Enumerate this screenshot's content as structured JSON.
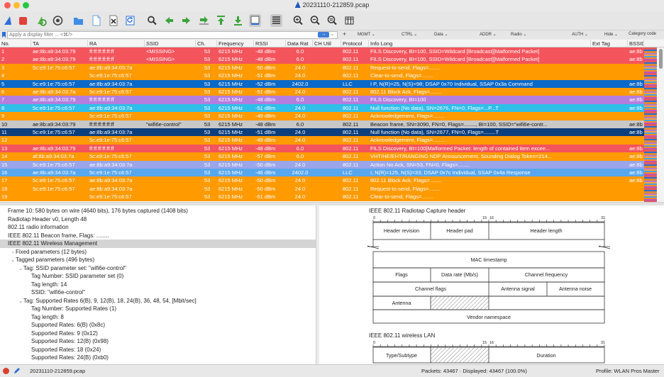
{
  "window": {
    "title": "20231110-212859.pcap"
  },
  "filter": {
    "placeholder": "Apply a display filter ... <⌘/>",
    "apply_label": "→",
    "dropdown_label": "⌄",
    "add_label": "+"
  },
  "quick_buttons": [
    {
      "label": "MGMT ⌄"
    },
    {
      "label": "CTRL ⌄"
    },
    {
      "label": "Data ⌄"
    },
    {
      "label": "ADDR ⌄"
    },
    {
      "label": "Radio ⌄"
    },
    {
      "label": "AUTH ⌄"
    },
    {
      "label": "Hide ⌄"
    },
    {
      "label": "Category code"
    }
  ],
  "toolbar_icons": [
    "shark-fin-start-icon",
    "stop-square-icon",
    "restart-capture-icon",
    "capture-options-icon",
    "open-folder-icon",
    "save-file-icon",
    "close-file-icon",
    "reload-file-icon",
    "find-packet-icon",
    "go-back-icon",
    "go-forward-icon",
    "go-to-packet-icon",
    "go-first-icon",
    "go-last-icon",
    "autoscroll-icon",
    "colorize-icon",
    "zoom-in-icon",
    "zoom-out-icon",
    "zoom-reset-icon",
    "resize-columns-icon"
  ],
  "columns": [
    "No.",
    "TA",
    "RA",
    "SSID",
    "Ch.",
    "Frequency",
    "RSSI",
    "Data Rat",
    "CH Util",
    "Protocol",
    "Info Long",
    "Ext Tag",
    "BSSID"
  ],
  "colors": {
    "red": "#f4545c",
    "orange": "#ff9a00",
    "blue": "#0968c8",
    "purple": "#b47ede",
    "cyan": "#2fbfe8",
    "lightblue": "#57a7ee",
    "lavender": "#9aa5ea",
    "gray": "#c8c8c8",
    "navy": "#0d3f7d"
  },
  "packets": [
    {
      "no": "1",
      "ta": "ae:8b:a9:34:03:79",
      "ra": "ff:ff:ff:ff:ff:ff",
      "ssid": "<MISSING>",
      "ch": "53",
      "freq": "6215 MHz",
      "rssi": "-48 dBm",
      "rate": "6.0",
      "util": "",
      "proto": "802.11",
      "info": "FILS Discovery, BI=100, SSID=Wildcard [Broadcast][Malformed Packet]",
      "ext": "",
      "bssid": "ae:8b",
      "color": "red"
    },
    {
      "no": "2",
      "ta": "ae:8b:a9:34:03:79",
      "ra": "ff:ff:ff:ff:ff:ff",
      "ssid": "<MISSING>",
      "ch": "53",
      "freq": "6215 MHz",
      "rssi": "-48 dBm",
      "rate": "6.0",
      "util": "",
      "proto": "802.11",
      "info": "FILS Discovery, BI=100, SSID=Wildcard [Broadcast][Malformed Packet]",
      "ext": "",
      "bssid": "ae:8b",
      "color": "red"
    },
    {
      "no": "3",
      "ta": "5c:e9:1e:75:c6:57",
      "ra": "ae:8b:a9:34:03:7a",
      "ssid": "",
      "ch": "53",
      "freq": "6215 MHz",
      "rssi": "-50 dBm",
      "rate": "24.0",
      "util": "",
      "proto": "802.11",
      "info": "Request-to-send, Flags=........",
      "ext": "",
      "bssid": "",
      "color": "orange"
    },
    {
      "no": "4",
      "ta": "",
      "ra": "5c:e9:1e:75:c6:57",
      "ssid": "",
      "ch": "53",
      "freq": "6215 MHz",
      "rssi": "-51 dBm",
      "rate": "24.0",
      "util": "",
      "proto": "802.11",
      "info": "Clear-to-send, Flags=........",
      "ext": "",
      "bssid": "",
      "color": "orange"
    },
    {
      "no": "5",
      "ta": "5c:e9:1e:75:c6:57",
      "ra": "ae:8b:a9:34:03:7a",
      "ssid": "",
      "ch": "53",
      "freq": "6215 MHz",
      "rssi": "-52 dBm",
      "rate": "2402.0",
      "util": "",
      "proto": "LLC",
      "info": "I P, N(R)=25, N(S)=98; DSAP 0x70 Individual, SSAP 0x3a Command",
      "ext": "",
      "bssid": "ae:8b",
      "color": "blue"
    },
    {
      "no": "6",
      "ta": "ae:8b:a9:34:03:7a",
      "ra": "5c:e9:1e:75:c6:57",
      "ssid": "",
      "ch": "53",
      "freq": "6215 MHz",
      "rssi": "-51 dBm",
      "rate": "24.0",
      "util": "",
      "proto": "802.11",
      "info": "802.11 Block Ack, Flags=........",
      "ext": "",
      "bssid": "ae:8b",
      "color": "orange"
    },
    {
      "no": "7",
      "ta": "ae:8b:a9:34:03:79",
      "ra": "ff:ff:ff:ff:ff:ff",
      "ssid": "",
      "ch": "53",
      "freq": "6215 MHz",
      "rssi": "-48 dBm",
      "rate": "6.0",
      "util": "",
      "proto": "802.11",
      "info": "FILS Discovery, BI=100",
      "ext": "",
      "bssid": "ae:8b",
      "color": "purple"
    },
    {
      "no": "8",
      "ta": "5c:e9:1e:75:c6:57",
      "ra": "ae:8b:a9:34:03:7a",
      "ssid": "",
      "ch": "53",
      "freq": "6215 MHz",
      "rssi": "-51 dBm",
      "rate": "24.0",
      "util": "",
      "proto": "802.11",
      "info": "Null function (No data), SN=2676, FN=0, Flags=...P...T",
      "ext": "",
      "bssid": "ae:8b",
      "color": "cyan"
    },
    {
      "no": "9",
      "ta": "",
      "ra": "5c:e9:1e:75:c6:57",
      "ssid": "",
      "ch": "53",
      "freq": "6215 MHz",
      "rssi": "-49 dBm",
      "rate": "24.0",
      "util": "",
      "proto": "802.11",
      "info": "Acknowledgement, Flags=........",
      "ext": "",
      "bssid": "",
      "color": "orange"
    },
    {
      "no": "10",
      "ta": "ae:8b:a9:34:03:79",
      "ra": "ff:ff:ff:ff:ff:ff",
      "ssid": "\"wifi6e-control\"",
      "ch": "53",
      "freq": "6215 MHz",
      "rssi": "-48 dBm",
      "rate": "6.0",
      "util": "",
      "proto": "802.11",
      "info": "Beacon frame, SN=3090, FN=0, Flags=........, BI=100, SSID=\"wifi6e-contr...",
      "ext": "",
      "bssid": "ae:8b",
      "color": "gray"
    },
    {
      "no": "11",
      "ta": "5c:e9:1e:75:c6:57",
      "ra": "ae:8b:a9:34:03:7a",
      "ssid": "",
      "ch": "53",
      "freq": "6215 MHz",
      "rssi": "-51 dBm",
      "rate": "24.0",
      "util": "",
      "proto": "802.11",
      "info": "Null function (No data), SN=2677, FN=0, Flags=........T",
      "ext": "",
      "bssid": "ae:8b",
      "color": "navy"
    },
    {
      "no": "12",
      "ta": "",
      "ra": "5c:e9:1e:75:c6:57",
      "ssid": "",
      "ch": "53",
      "freq": "6215 MHz",
      "rssi": "-49 dBm",
      "rate": "24.0",
      "util": "",
      "proto": "802.11",
      "info": "Acknowledgement, Flags=........",
      "ext": "",
      "bssid": "",
      "color": "orange"
    },
    {
      "no": "13",
      "ta": "ae:8b:a9:34:03:79",
      "ra": "ff:ff:ff:ff:ff:ff",
      "ssid": "",
      "ch": "53",
      "freq": "6215 MHz",
      "rssi": "-48 dBm",
      "rate": "6.0",
      "util": "",
      "proto": "802.11",
      "info": "FILS Discovery, BI=100[Malformed Packet: length of contained item excee...",
      "ext": "",
      "bssid": "ae:8b",
      "color": "red"
    },
    {
      "no": "14",
      "ta": "af:8b:a9:34:03:7a",
      "ra": "5c:e9:1e:75:c6:57",
      "ssid": "",
      "ch": "53",
      "freq": "6215 MHz",
      "rssi": "-57 dBm",
      "rate": "6.0",
      "util": "",
      "proto": "802.11",
      "info": "VHT/HE/EHT/RANGING NDP Announcement, Sounding Dialog Token=214...",
      "ext": "",
      "bssid": "ae:8b",
      "color": "orange"
    },
    {
      "no": "15",
      "ta": "5c:e9:1e:75:c6:57",
      "ra": "ae:8b:a9:34:03:7a",
      "ssid": "",
      "ch": "53",
      "freq": "6215 MHz",
      "rssi": "-50 dBm",
      "rate": "24.0",
      "util": "",
      "proto": "802.11",
      "info": "Action No Ack, SN=53, FN=0, Flags=........",
      "ext": "",
      "bssid": "ae:8b",
      "color": "lavender"
    },
    {
      "no": "16",
      "ta": "ae:8b:a9:34:03:7a",
      "ra": "5c:e9:1e:75:c6:57",
      "ssid": "",
      "ch": "53",
      "freq": "6215 MHz",
      "rssi": "-46 dBm",
      "rate": "2402.0",
      "util": "",
      "proto": "LLC",
      "info": "I, N(R)=125, N(S)=33; DSAP 0x7c Individual, SSAP 0x4a Response",
      "ext": "",
      "bssid": "ae:8b",
      "color": "lightblue"
    },
    {
      "no": "17",
      "ta": "5c:e9:1e:75:c6:57",
      "ra": "ae:8b:a9:34:03:7a",
      "ssid": "",
      "ch": "53",
      "freq": "6215 MHz",
      "rssi": "-50 dBm",
      "rate": "24.0",
      "util": "",
      "proto": "802.11",
      "info": "802.11 Block Ack, Flags=........",
      "ext": "",
      "bssid": "ae:8b",
      "color": "orange"
    },
    {
      "no": "18",
      "ta": "5c:e9:1e:75:c6:57",
      "ra": "ae:8b:a9:34:03:7a",
      "ssid": "",
      "ch": "53",
      "freq": "6215 MHz",
      "rssi": "-50 dBm",
      "rate": "24.0",
      "util": "",
      "proto": "802.11",
      "info": "Request-to-send, Flags=........",
      "ext": "",
      "bssid": "",
      "color": "orange"
    },
    {
      "no": "19",
      "ta": "",
      "ra": "5c:e9:1e:75:c6:57",
      "ssid": "",
      "ch": "53",
      "freq": "6215 MHz",
      "rssi": "-51 dBm",
      "rate": "24.0",
      "util": "",
      "proto": "802.11",
      "info": "Clear-to-send, Flags=........",
      "ext": "",
      "bssid": "",
      "color": "orange"
    }
  ],
  "details": [
    {
      "text": "Frame 10: 580 bytes on wire (4640 bits), 176 bytes captured (1408 bits)",
      "level": 0,
      "caret": ""
    },
    {
      "text": "Radiotap Header v0, Length 48",
      "level": 0,
      "caret": ""
    },
    {
      "text": "802.11 radio information",
      "level": 0,
      "caret": ""
    },
    {
      "text": "IEEE 802.11 Beacon frame, Flags: ........",
      "level": 0,
      "caret": ""
    },
    {
      "text": "IEEE 802.11 Wireless Management",
      "level": 0,
      "caret": "",
      "sel": true
    },
    {
      "text": "Fixed parameters (12 bytes)",
      "level": 1,
      "caret": "›"
    },
    {
      "text": "Tagged parameters (496 bytes)",
      "level": 1,
      "caret": "⌄"
    },
    {
      "text": "Tag: SSID parameter set: \"wifi6e-control\"",
      "level": 2,
      "caret": "⌄"
    },
    {
      "text": "Tag Number: SSID parameter set (0)",
      "level": 3,
      "caret": ""
    },
    {
      "text": "Tag length: 14",
      "level": 3,
      "caret": ""
    },
    {
      "text": "SSID: \"wifi6e-control\"",
      "level": 3,
      "caret": ""
    },
    {
      "text": "Tag: Supported Rates 6(B), 9, 12(B), 18, 24(B), 36, 48, 54, [Mbit/sec]",
      "level": 2,
      "caret": "⌄"
    },
    {
      "text": "Tag Number: Supported Rates (1)",
      "level": 3,
      "caret": ""
    },
    {
      "text": "Tag length: 8",
      "level": 3,
      "caret": ""
    },
    {
      "text": "Supported Rates: 6(B) (0x8c)",
      "level": 3,
      "caret": ""
    },
    {
      "text": "Supported Rates: 9 (0x12)",
      "level": 3,
      "caret": ""
    },
    {
      "text": "Supported Rates: 12(B) (0x98)",
      "level": 3,
      "caret": ""
    },
    {
      "text": "Supported Rates: 18 (0x24)",
      "level": 3,
      "caret": ""
    },
    {
      "text": "Supported Rates: 24(B) (0xb0)",
      "level": 3,
      "caret": ""
    }
  ],
  "diagram": {
    "radiotap_title": "IEEE 802.11 Radiotap Capture header",
    "wlan_title": "IEEE 802.11 wireless LAN",
    "bits": {
      "zero": "0",
      "b15": "15",
      "b16": "16",
      "b31": "31"
    },
    "fields": {
      "header_revision": "Header revision",
      "header_pad": "Header pad",
      "header_length": "Header length",
      "mac_timestamp": "MAC timestamp",
      "flags": "Flags",
      "data_rate": "Data rate (Mb/s)",
      "channel_frequency": "Channel frequency",
      "channel_flags": "Channel flags",
      "antenna_signal": "Antenna signal",
      "antenna_noise": "Antenna noise",
      "antenna": "Antenna",
      "vendor_namespace": "Vendor namespace",
      "type_subtype": "Type/Subtype",
      "duration": "Duration"
    }
  },
  "status": {
    "file": "20231110-212859.pcap",
    "packets": "Packets: 43467 · Displayed: 43467 (100.0%)",
    "profile": "Profile: WLAN Pros Master"
  }
}
